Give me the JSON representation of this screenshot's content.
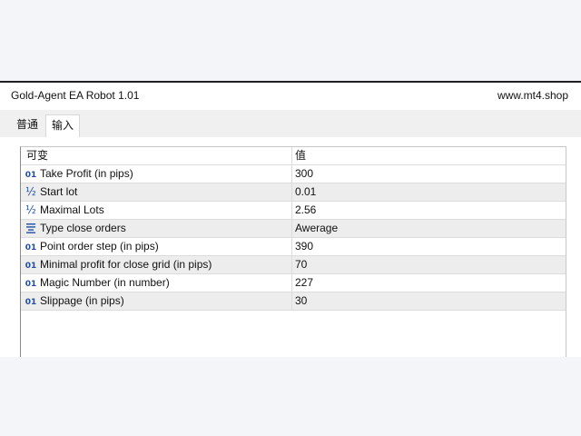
{
  "window": {
    "title": "Gold-Agent EA Robot 1.01",
    "site": "www.mt4.shop"
  },
  "tabs": [
    {
      "label": "普通",
      "active": false
    },
    {
      "label": "输入",
      "active": true
    }
  ],
  "table": {
    "headers": {
      "variable": "可变",
      "value": "值"
    },
    "rows": [
      {
        "icon": "int-icon",
        "icon_text": "01",
        "name": "Take Profit (in pips)",
        "value": "300"
      },
      {
        "icon": "double-icon",
        "icon_text": "½",
        "name": "Start lot",
        "value": "0.01"
      },
      {
        "icon": "double-icon",
        "icon_text": "½",
        "name": "Maximal Lots",
        "value": "2.56"
      },
      {
        "icon": "enum-icon",
        "icon_text": "",
        "name": "Type close orders",
        "value": "Awerage"
      },
      {
        "icon": "int-icon",
        "icon_text": "01",
        "name": "Point order step (in pips)",
        "value": "390"
      },
      {
        "icon": "int-icon",
        "icon_text": "01",
        "name": "Minimal profit for close grid (in pips)",
        "value": "70"
      },
      {
        "icon": "int-icon",
        "icon_text": "01",
        "name": "Magic Number (in number)",
        "value": "227"
      },
      {
        "icon": "int-icon",
        "icon_text": "01",
        "name": "Slippage (in pips)",
        "value": "30"
      }
    ]
  },
  "colors": {
    "icon_blue": "#1f4ea8",
    "alt_row": "#ededed",
    "tab_strip": "#f0f0f0"
  }
}
